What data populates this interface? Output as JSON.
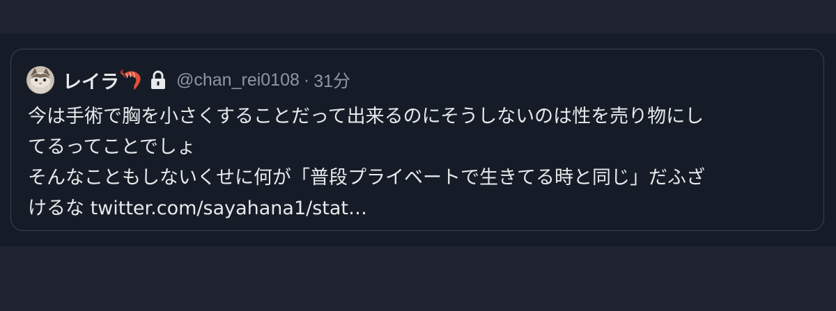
{
  "quote": {
    "display_name": "レイラ",
    "name_emoji_icon": "shrimp-icon",
    "protected_icon": "lock-icon",
    "handle": "@chan_rei0108",
    "separator": "·",
    "time": "31分",
    "text_lines": [
      "今は手術で胸を小さくすることだって出来るのにそうしないのは性を売り物にし",
      "てるってことでしょ",
      "そんなこともしないくせに何が「普段プライベートで生きてる時と同じ」だふざ",
      "けるな twitter.com/sayahana1/stat…"
    ]
  },
  "colors": {
    "background": "#1f2430",
    "card_background": "#161c27",
    "card_border": "#3a4150",
    "primary_text": "#e7e9ea",
    "secondary_text": "#8b98a5",
    "shrimp": "#e0503a"
  }
}
